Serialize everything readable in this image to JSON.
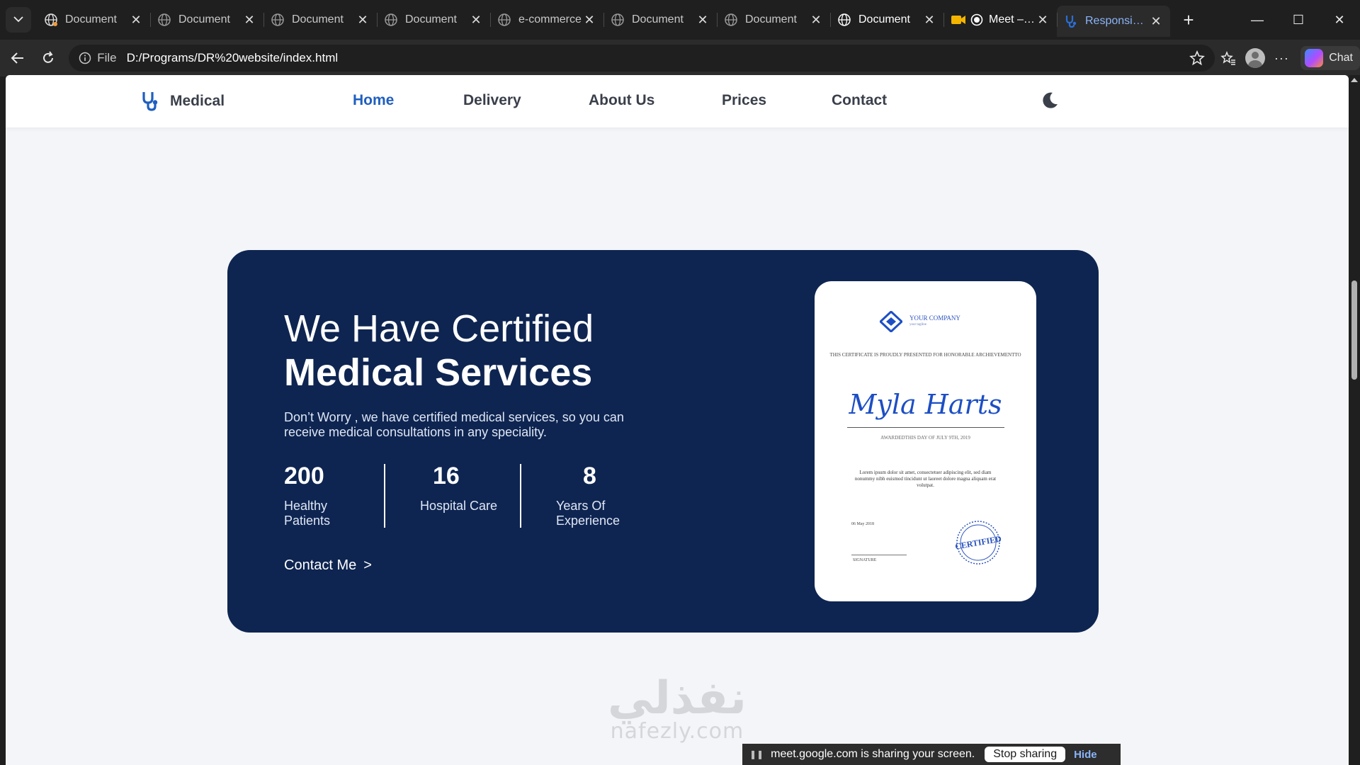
{
  "browser": {
    "tabs": [
      {
        "title": "Document",
        "close": "✕"
      },
      {
        "title": "Document",
        "close": "✕"
      },
      {
        "title": "Document",
        "close": "✕"
      },
      {
        "title": "Document",
        "close": "✕"
      },
      {
        "title": "e-commerce",
        "close": "✕"
      },
      {
        "title": "Document",
        "close": "✕"
      },
      {
        "title": "Document",
        "close": "✕"
      },
      {
        "title": "Document",
        "close": "✕"
      },
      {
        "title": "Meet – th",
        "close": "✕"
      },
      {
        "title": "Responsive m",
        "close": "✕"
      }
    ],
    "new_tab": "+",
    "address": {
      "file_label": "File",
      "url": "D:/Programs/DR%20website/index.html"
    },
    "chat_label": "Chat"
  },
  "site": {
    "logo_text": "Medical",
    "nav": [
      "Home",
      "Delivery",
      "About Us",
      "Prices",
      "Contact"
    ],
    "active_nav": "Home",
    "accent_color": "#1f5fbf",
    "card_color": "#0e2551"
  },
  "hero": {
    "title_light": "We Have Certified",
    "title_bold": "Medical Services",
    "description": "Don’t Worry , we have certified medical services, so you can receive medical consultations in any speciality.",
    "stats": [
      {
        "value": "200",
        "label": "Healthy Patients"
      },
      {
        "value": "16",
        "label": "Hospital Care"
      },
      {
        "value": "8",
        "label": "Years Of Experience"
      }
    ],
    "cta_label": "Contact Me",
    "cta_chevron": ">"
  },
  "certificate": {
    "company": "YOUR COMPANY",
    "tagline": "your tagline",
    "presented": "THIS CERTIFICATE IS PROUDLY PRESENTED FOR HONORABLE ARCHIEVEMENTTO",
    "name": "Myla Harts",
    "awarded": "AWARDEDTHIS DAY OF JULY 9TH, 2019",
    "body": "Lorem ipsum dolor sit amet, consectetuer adipiscing elit, sed diam nonummy nibh euismod tincidunt ut laoreet dolore magna aliquam erat volutpat.",
    "date": "06 May 2018",
    "signature_label": "SIGNATURE",
    "stamp_text": "CERTIFIED"
  },
  "watermark": {
    "arabic": "نفذلي",
    "latin": "nafezly.com"
  },
  "share_bar": {
    "message": "meet.google.com is sharing your screen.",
    "stop_label": "Stop sharing",
    "hide_label": "Hide"
  }
}
